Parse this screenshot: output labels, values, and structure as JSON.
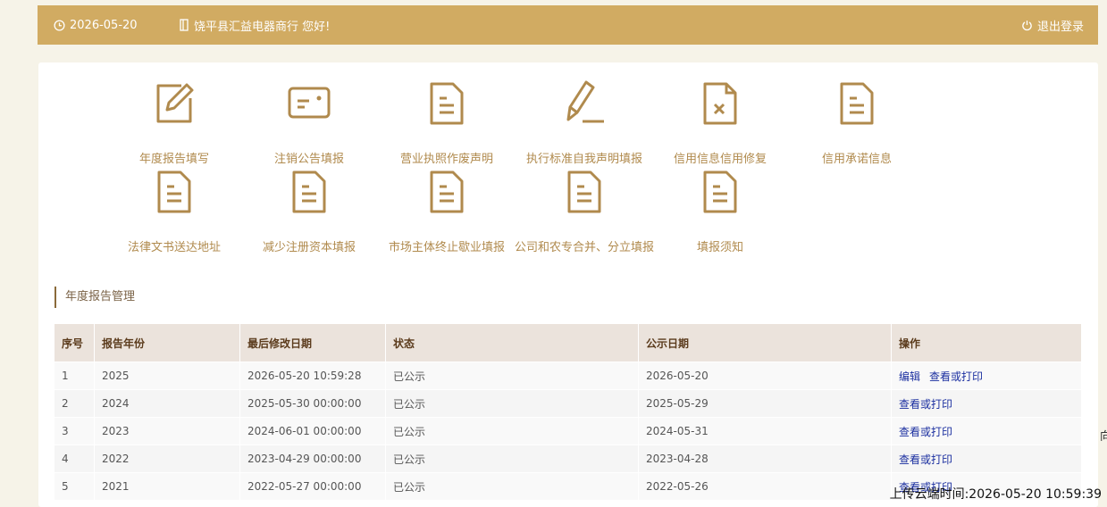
{
  "header": {
    "date": "2026-05-20",
    "greeting": "饶平县汇益电器商行 您好!",
    "logout_label": "退出登录"
  },
  "tiles": [
    {
      "label": "年度报告填写",
      "icon": "edit-icon"
    },
    {
      "label": "注销公告填报",
      "icon": "card-icon"
    },
    {
      "label": "营业执照作废声明",
      "icon": "document-icon"
    },
    {
      "label": "执行标准自我声明填报",
      "icon": "pencil-icon"
    },
    {
      "label": "信用信息信用修复",
      "icon": "document-x-icon"
    },
    {
      "label": "信用承诺信息",
      "icon": "document-icon"
    },
    {
      "label": "法律文书送达地址",
      "icon": "document-icon"
    },
    {
      "label": "减少注册资本填报",
      "icon": "document-icon"
    },
    {
      "label": "市场主体终止歇业填报",
      "icon": "document-icon"
    },
    {
      "label": "公司和农专合并、分立填报",
      "icon": "document-icon"
    },
    {
      "label": "填报须知",
      "icon": "document-icon"
    }
  ],
  "section": {
    "title": "年度报告管理"
  },
  "table": {
    "headers": [
      "序号",
      "报告年份",
      "最后修改日期",
      "状态",
      "公示日期",
      "操作"
    ],
    "rows": [
      {
        "no": "1",
        "year": "2025",
        "modified": "2026-05-20 10:59:28",
        "status": "已公示",
        "published": "2026-05-20",
        "ops": [
          "编辑",
          "查看或打印"
        ]
      },
      {
        "no": "2",
        "year": "2024",
        "modified": "2025-05-30 00:00:00",
        "status": "已公示",
        "published": "2025-05-29",
        "ops": [
          "查看或打印"
        ]
      },
      {
        "no": "3",
        "year": "2023",
        "modified": "2024-06-01 00:00:00",
        "status": "已公示",
        "published": "2024-05-31",
        "ops": [
          "查看或打印"
        ]
      },
      {
        "no": "4",
        "year": "2022",
        "modified": "2023-04-29 00:00:00",
        "status": "已公示",
        "published": "2023-04-28",
        "ops": [
          "查看或打印"
        ]
      },
      {
        "no": "5",
        "year": "2021",
        "modified": "2022-05-27 00:00:00",
        "status": "已公示",
        "published": "2022-05-26",
        "ops": [
          "查看或打印"
        ]
      }
    ]
  },
  "footer": {
    "upload_time": "上传云端时间:2026-05-20 10:59:39",
    "edge_char": "向"
  },
  "colors": {
    "topbar": "#d1ab62",
    "icon": "#b08a4d",
    "link": "#1b2fa0",
    "header_row": "#ebe3dc"
  }
}
